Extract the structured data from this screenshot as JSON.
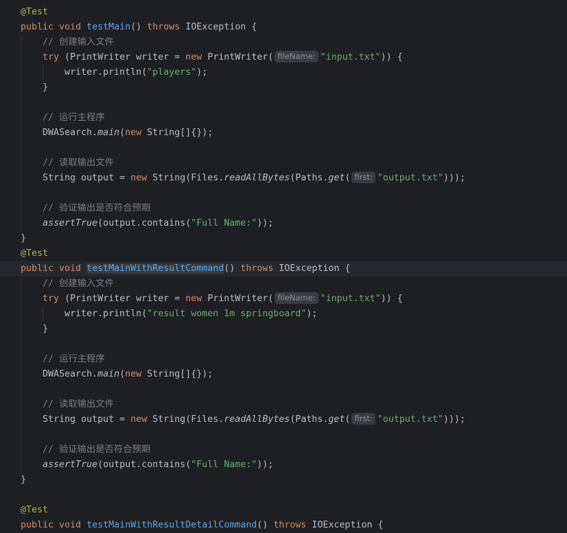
{
  "lines": [
    {
      "indent": 0,
      "tokens": [
        {
          "t": "@Test",
          "c": "ann"
        }
      ]
    },
    {
      "indent": 0,
      "tokens": [
        {
          "t": "public void ",
          "c": "kw"
        },
        {
          "t": "testMain",
          "c": "fn"
        },
        {
          "t": "() ",
          "c": "plain"
        },
        {
          "t": "throws ",
          "c": "kw"
        },
        {
          "t": "IOException {",
          "c": "plain"
        }
      ]
    },
    {
      "indent": 1,
      "tokens": [
        {
          "t": "// 创建输入文件",
          "c": "cmt"
        }
      ]
    },
    {
      "indent": 1,
      "tokens": [
        {
          "t": "try ",
          "c": "kw"
        },
        {
          "t": "(PrintWriter writer = ",
          "c": "plain"
        },
        {
          "t": "new ",
          "c": "kw"
        },
        {
          "t": "PrintWriter(",
          "c": "plain"
        },
        {
          "t": "fileName:",
          "c": "hint"
        },
        {
          "t": "\"input.txt\"",
          "c": "str"
        },
        {
          "t": ")) {",
          "c": "plain"
        }
      ]
    },
    {
      "indent": 2,
      "tokens": [
        {
          "t": "writer.println(",
          "c": "plain"
        },
        {
          "t": "\"players\"",
          "c": "str"
        },
        {
          "t": ");",
          "c": "plain"
        }
      ]
    },
    {
      "indent": 1,
      "tokens": [
        {
          "t": "}",
          "c": "plain"
        }
      ]
    },
    {
      "indent": 0,
      "tokens": []
    },
    {
      "indent": 1,
      "tokens": [
        {
          "t": "// 运行主程序",
          "c": "cmt"
        }
      ]
    },
    {
      "indent": 1,
      "tokens": [
        {
          "t": "DWASearch.",
          "c": "plain"
        },
        {
          "t": "main",
          "c": "it"
        },
        {
          "t": "(",
          "c": "plain"
        },
        {
          "t": "new ",
          "c": "kw"
        },
        {
          "t": "String[]{});",
          "c": "plain"
        }
      ]
    },
    {
      "indent": 0,
      "tokens": []
    },
    {
      "indent": 1,
      "tokens": [
        {
          "t": "// 读取输出文件",
          "c": "cmt"
        }
      ]
    },
    {
      "indent": 1,
      "tokens": [
        {
          "t": "String output = ",
          "c": "plain"
        },
        {
          "t": "new ",
          "c": "kw"
        },
        {
          "t": "String(Files.",
          "c": "plain"
        },
        {
          "t": "readAllBytes",
          "c": "it"
        },
        {
          "t": "(Paths.",
          "c": "plain"
        },
        {
          "t": "get",
          "c": "it"
        },
        {
          "t": "(",
          "c": "plain"
        },
        {
          "t": "first:",
          "c": "hint"
        },
        {
          "t": "\"output.txt\"",
          "c": "str"
        },
        {
          "t": ")));",
          "c": "plain"
        }
      ]
    },
    {
      "indent": 0,
      "tokens": []
    },
    {
      "indent": 1,
      "tokens": [
        {
          "t": "// 验证输出是否符合预期",
          "c": "cmt"
        }
      ]
    },
    {
      "indent": 1,
      "tokens": [
        {
          "t": "assertTrue",
          "c": "it"
        },
        {
          "t": "(output.contains(",
          "c": "plain"
        },
        {
          "t": "\"Full Name:\"",
          "c": "str"
        },
        {
          "t": "));",
          "c": "plain"
        }
      ]
    },
    {
      "indent": 0,
      "tokens": [
        {
          "t": "}",
          "c": "plain"
        }
      ]
    },
    {
      "indent": 0,
      "tokens": [
        {
          "t": "@Test",
          "c": "ann"
        }
      ]
    },
    {
      "indent": 0,
      "current": true,
      "tokens": [
        {
          "t": "public void ",
          "c": "kw"
        },
        {
          "t": "testMainWithResultCommand",
          "c": "fn sel"
        },
        {
          "t": "() ",
          "c": "plain"
        },
        {
          "t": "throws ",
          "c": "kw"
        },
        {
          "t": "IOException {",
          "c": "plain"
        }
      ]
    },
    {
      "indent": 1,
      "tokens": [
        {
          "t": "// 创建输入文件",
          "c": "cmt"
        }
      ]
    },
    {
      "indent": 1,
      "tokens": [
        {
          "t": "try ",
          "c": "kw"
        },
        {
          "t": "(PrintWriter writer = ",
          "c": "plain"
        },
        {
          "t": "new ",
          "c": "kw"
        },
        {
          "t": "PrintWriter(",
          "c": "plain"
        },
        {
          "t": "fileName:",
          "c": "hint"
        },
        {
          "t": "\"input.txt\"",
          "c": "str"
        },
        {
          "t": ")) {",
          "c": "plain"
        }
      ]
    },
    {
      "indent": 2,
      "tokens": [
        {
          "t": "writer.println(",
          "c": "plain"
        },
        {
          "t": "\"result women 1m springboard\"",
          "c": "str"
        },
        {
          "t": ");",
          "c": "plain"
        }
      ]
    },
    {
      "indent": 1,
      "tokens": [
        {
          "t": "}",
          "c": "plain"
        }
      ]
    },
    {
      "indent": 0,
      "tokens": []
    },
    {
      "indent": 1,
      "tokens": [
        {
          "t": "// 运行主程序",
          "c": "cmt"
        }
      ]
    },
    {
      "indent": 1,
      "tokens": [
        {
          "t": "DWASearch.",
          "c": "plain"
        },
        {
          "t": "main",
          "c": "it"
        },
        {
          "t": "(",
          "c": "plain"
        },
        {
          "t": "new ",
          "c": "kw"
        },
        {
          "t": "String[]{});",
          "c": "plain"
        }
      ]
    },
    {
      "indent": 0,
      "tokens": []
    },
    {
      "indent": 1,
      "tokens": [
        {
          "t": "// 读取输出文件",
          "c": "cmt"
        }
      ]
    },
    {
      "indent": 1,
      "tokens": [
        {
          "t": "String output = ",
          "c": "plain"
        },
        {
          "t": "new ",
          "c": "kw"
        },
        {
          "t": "String(Files.",
          "c": "plain"
        },
        {
          "t": "readAllBytes",
          "c": "it"
        },
        {
          "t": "(Paths.",
          "c": "plain"
        },
        {
          "t": "get",
          "c": "it"
        },
        {
          "t": "(",
          "c": "plain"
        },
        {
          "t": "first:",
          "c": "hint"
        },
        {
          "t": "\"output.txt\"",
          "c": "str"
        },
        {
          "t": ")));",
          "c": "plain"
        }
      ]
    },
    {
      "indent": 0,
      "tokens": []
    },
    {
      "indent": 1,
      "tokens": [
        {
          "t": "// 验证输出是否符合预期",
          "c": "cmt"
        }
      ]
    },
    {
      "indent": 1,
      "tokens": [
        {
          "t": "assertTrue",
          "c": "it"
        },
        {
          "t": "(output.contains(",
          "c": "plain"
        },
        {
          "t": "\"Full Name:\"",
          "c": "str"
        },
        {
          "t": "));",
          "c": "plain"
        }
      ]
    },
    {
      "indent": 0,
      "tokens": [
        {
          "t": "}",
          "c": "plain"
        }
      ]
    },
    {
      "indent": 0,
      "tokens": []
    },
    {
      "indent": 0,
      "tokens": [
        {
          "t": "@Test",
          "c": "ann"
        }
      ]
    },
    {
      "indent": 0,
      "tokens": [
        {
          "t": "public void ",
          "c": "kw"
        },
        {
          "t": "testMainWithResultDetailCommand",
          "c": "fn"
        },
        {
          "t": "() ",
          "c": "plain"
        },
        {
          "t": "throws ",
          "c": "kw"
        },
        {
          "t": "IOException {",
          "c": "plain"
        }
      ]
    }
  ],
  "colors": {
    "background": "#1e1f22",
    "keyword": "#cf8e6d",
    "function": "#56a8f5",
    "annotation": "#b3ae60",
    "string": "#6aab73",
    "comment": "#7a7e85"
  }
}
